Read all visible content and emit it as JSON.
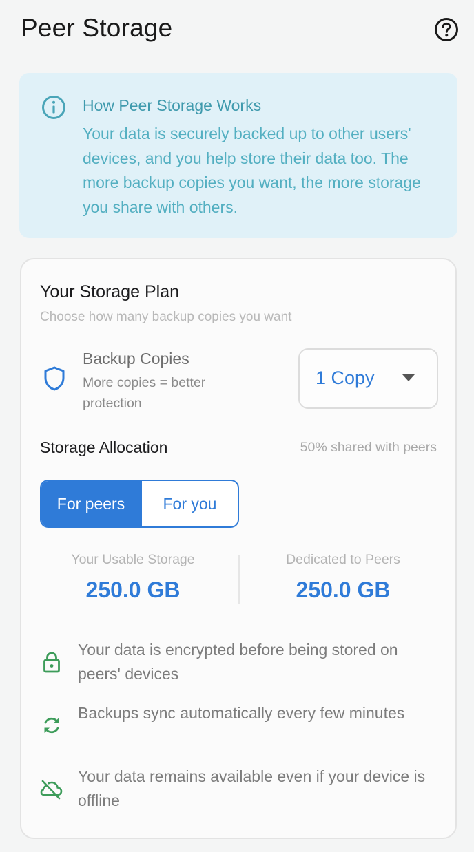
{
  "header": {
    "title": "Peer Storage",
    "help_icon": "help-circle-icon"
  },
  "info": {
    "icon": "info-circle-icon",
    "title": "How Peer Storage Works",
    "body": "Your data is securely backed up to other users' devices, and you help store their data too. The more backup copies you want, the more storage you share with others."
  },
  "plan": {
    "title": "Your Storage Plan",
    "subtitle": "Choose how many backup copies you want",
    "backup": {
      "icon": "shield-icon",
      "label": "Backup Copies",
      "description": "More copies = better protection",
      "selected": "1 Copy"
    },
    "allocation": {
      "title": "Storage Allocation",
      "share_text": "50% shared with peers",
      "share_fraction": 0.5,
      "toggle": [
        {
          "label": "For peers",
          "active": true
        },
        {
          "label": "For you",
          "active": false
        }
      ]
    },
    "stats": [
      {
        "label": "Your Usable Storage",
        "value": "250.0 GB"
      },
      {
        "label": "Dedicated to Peers",
        "value": "250.0 GB"
      }
    ],
    "features": [
      {
        "icon": "lock-icon",
        "text": "Your data is encrypted before being stored on peers' devices"
      },
      {
        "icon": "sync-icon",
        "text": "Backups sync automatically every few minutes"
      },
      {
        "icon": "cloud-off-icon",
        "text": "Your data remains available even if your device is offline"
      }
    ]
  },
  "colors": {
    "accent": "#2f7bd8",
    "info_bg": "#e0f1f8",
    "info_text": "#53afc1",
    "feature_icon": "#3d9c5a"
  }
}
